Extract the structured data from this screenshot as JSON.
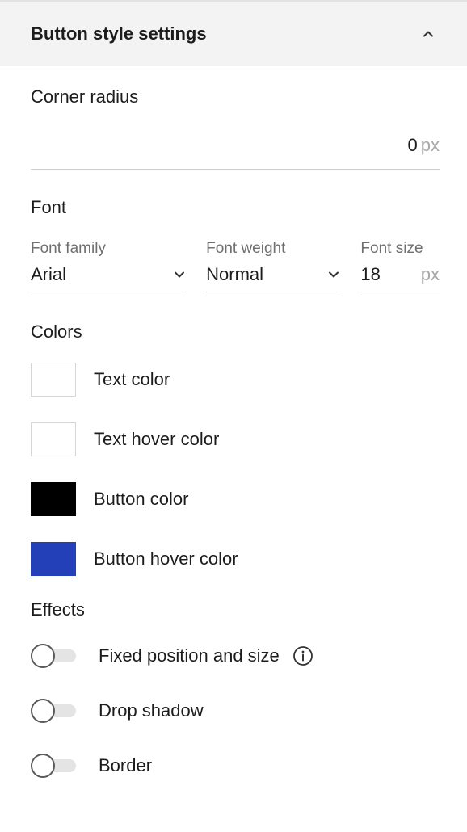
{
  "header": {
    "title": "Button style settings"
  },
  "corner_radius": {
    "title": "Corner radius",
    "value": "0",
    "unit": "px"
  },
  "font": {
    "title": "Font",
    "family": {
      "label": "Font family",
      "value": "Arial"
    },
    "weight": {
      "label": "Font weight",
      "value": "Normal"
    },
    "size": {
      "label": "Font size",
      "value": "18",
      "unit": "px"
    }
  },
  "colors": {
    "title": "Colors",
    "items": [
      {
        "label": "Text color",
        "swatch": "#ffffff"
      },
      {
        "label": "Text hover color",
        "swatch": "#ffffff"
      },
      {
        "label": "Button color",
        "swatch": "#000000"
      },
      {
        "label": "Button hover color",
        "swatch": "#2340b8"
      }
    ]
  },
  "effects": {
    "title": "Effects",
    "items": [
      {
        "label": "Fixed position and size",
        "enabled": false,
        "has_info": true
      },
      {
        "label": "Drop shadow",
        "enabled": false
      },
      {
        "label": "Border",
        "enabled": false
      }
    ]
  },
  "icons": {
    "collapse": "chevron-up-icon",
    "dropdown": "chevron-down-icon",
    "info": "info-icon"
  }
}
